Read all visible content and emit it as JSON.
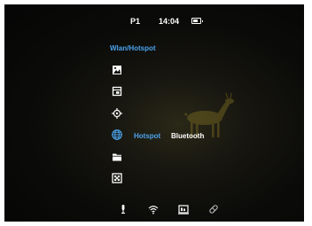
{
  "status": {
    "profile": "P1",
    "time": "14:04",
    "battery_level": 0.7
  },
  "menu": {
    "title": "Wlan/Hotspot",
    "items": [
      {
        "icon": "image-icon"
      },
      {
        "icon": "video-record-icon"
      },
      {
        "icon": "crosshair-icon"
      },
      {
        "icon": "globe-icon",
        "selected": true
      },
      {
        "icon": "folder-icon"
      },
      {
        "icon": "settings-box-icon"
      }
    ],
    "submenu": {
      "active_option": "Hotspot",
      "other_option": "Bluetooth"
    }
  },
  "bottom_bar": [
    "microphone-icon",
    "wifi-icon",
    "photo-mode-icon",
    "pip-icon"
  ],
  "colors": {
    "accent": "#4aa3ec",
    "text": "#ffffff",
    "background": "#0a0a09"
  }
}
